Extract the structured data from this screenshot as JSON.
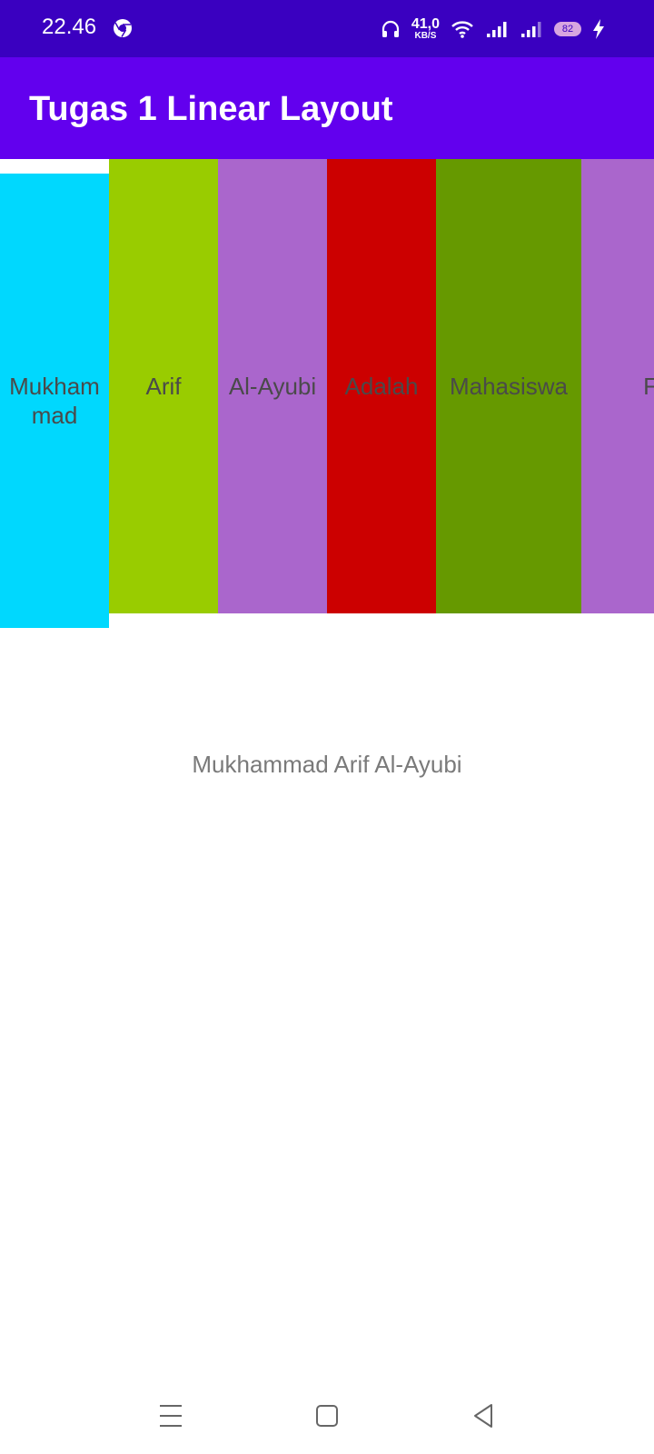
{
  "status_bar": {
    "time": "22.46",
    "speed_value": "41,0",
    "speed_unit": "KB/S",
    "battery": "82",
    "icons": [
      "chrome-icon",
      "headphones-icon",
      "wifi-icon",
      "signal-icon",
      "signal-icon-2",
      "battery-icon",
      "charging-icon"
    ]
  },
  "app_bar": {
    "title": "Tugas 1 Linear Layout"
  },
  "boxes": [
    {
      "label": "Mukhammad",
      "label_lines": [
        "Mukham",
        "mad"
      ],
      "color": "#00d8fe"
    },
    {
      "label": "Arif",
      "color": "#99cc00"
    },
    {
      "label": "Al-Ayubi",
      "color": "#aa66cc"
    },
    {
      "label": "Adalah",
      "color": "#cc0000"
    },
    {
      "label": "Mahasiswa",
      "color": "#669900"
    },
    {
      "label": "F",
      "color": "#aa66cc"
    }
  ],
  "center_text": "Mukhammad Arif Al-Ayubi",
  "nav_bar": {
    "icons": [
      "menu-icon",
      "home-icon",
      "back-icon"
    ]
  }
}
